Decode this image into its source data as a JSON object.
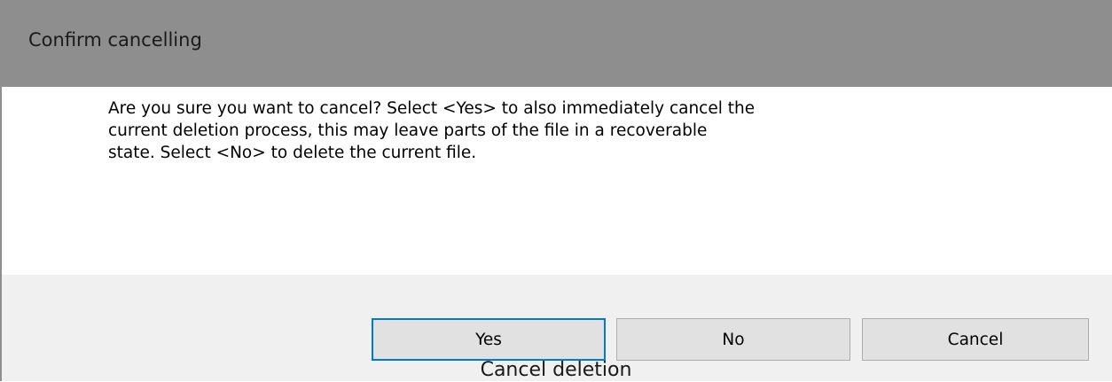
{
  "dialog": {
    "title": "Confirm cancelling",
    "message_lines": [
      "Are you sure you want to cancel? Select <Yes> to also immediately cancel the",
      "current deletion process, this may leave parts of the file in a recoverable",
      "state. Select <No> to delete the current file."
    ],
    "buttons": {
      "yes": "Yes",
      "no": "No",
      "cancel": "Cancel"
    },
    "default_button": "yes"
  },
  "caption": "Cancel deletion",
  "colors": {
    "titlebar": "#8e8e8e",
    "button_bar": "#f0f0f0",
    "button_face": "#e1e1e1",
    "focus_border": "#0078d7"
  }
}
